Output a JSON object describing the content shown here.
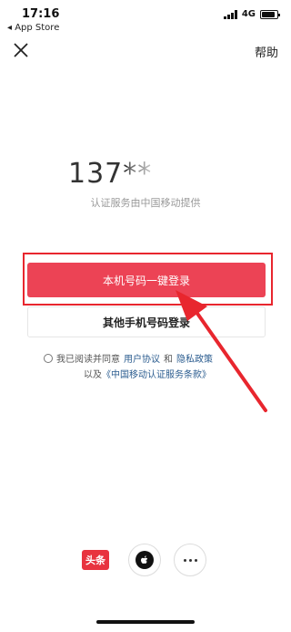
{
  "status_bar": {
    "time": "17:16",
    "back_app": "◂ App Store",
    "network": "4G"
  },
  "nav": {
    "help_label": "帮助"
  },
  "phone": {
    "masked_number": "137**",
    "provider_note": "认证服务由中国移动提供"
  },
  "buttons": {
    "one_click_login": "本机号码一键登录",
    "other_phone_login": "其他手机号码登录"
  },
  "agreement": {
    "prefix": "我已阅读并同意",
    "user_agreement": "用户协议",
    "and": "和",
    "privacy_policy": "隐私政策",
    "line2_prefix": "以及",
    "cmcc_terms": "《中国移动认证服务条款》"
  },
  "social_login": {
    "toutiao_label": "头条",
    "icons": [
      "toutiao-icon",
      "apple-icon",
      "more-icon"
    ]
  },
  "colors": {
    "primary_button": "#ec4355",
    "highlight_box": "#e8262e",
    "arrow": "#e8262e",
    "link": "#2b5c8f",
    "toutiao": "#e8333f"
  }
}
